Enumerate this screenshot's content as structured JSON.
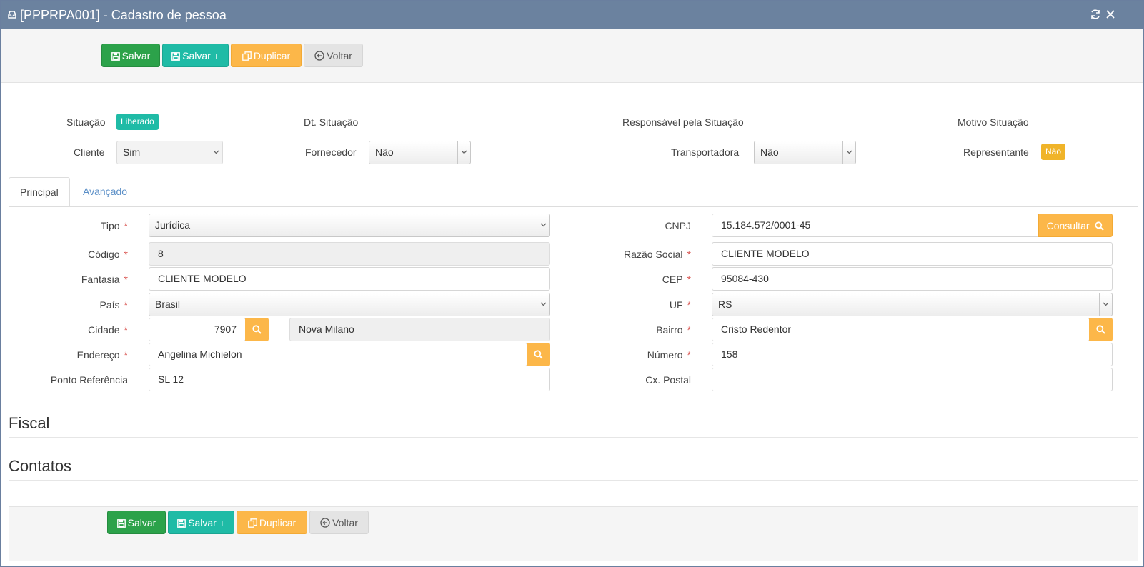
{
  "window": {
    "title": "[PPPRPA001] - Cadastro de pessoa",
    "icons": [
      "inbox-icon",
      "refresh-icon",
      "close-icon"
    ]
  },
  "toolbar": {
    "save": "Salvar",
    "save_plus": "Salvar +",
    "duplicate": "Duplicar",
    "back": "Voltar"
  },
  "status": {
    "situacao_label": "Situação",
    "situacao_value": "Liberado",
    "dt_situacao_label": "Dt. Situação",
    "responsavel_label": "Responsável pela Situação",
    "motivo_label": "Motivo Situação",
    "cliente_label": "Cliente",
    "cliente_value": "Sim",
    "fornecedor_label": "Fornecedor",
    "fornecedor_value": "Não",
    "transportadora_label": "Transportadora",
    "transportadora_value": "Não",
    "representante_label": "Representante",
    "representante_value": "Não"
  },
  "tabs": [
    {
      "label": "Principal",
      "active": true
    },
    {
      "label": "Avançado",
      "active": false
    }
  ],
  "form": {
    "required_mark": "*",
    "tipo": {
      "label": "Tipo",
      "value": "Jurídica"
    },
    "codigo": {
      "label": "Código",
      "value": "8"
    },
    "fantasia": {
      "label": "Fantasia",
      "value": "CLIENTE MODELO"
    },
    "pais": {
      "label": "País",
      "value": "Brasil"
    },
    "cidade": {
      "label": "Cidade",
      "code": "7907",
      "name": "Nova Milano"
    },
    "endereco": {
      "label": "Endereço",
      "value": "Angelina Michielon"
    },
    "ponto_referencia": {
      "label": "Ponto Referência",
      "value": "SL 12"
    },
    "cnpj": {
      "label": "CNPJ",
      "value": "15.184.572/0001-45",
      "button": "Consultar"
    },
    "razao_social": {
      "label": "Razão Social",
      "value": "CLIENTE MODELO"
    },
    "cep": {
      "label": "CEP",
      "value": "95084-430"
    },
    "uf": {
      "label": "UF",
      "value": "RS"
    },
    "bairro": {
      "label": "Bairro",
      "value": "Cristo Redentor"
    },
    "numero": {
      "label": "Número",
      "value": "158"
    },
    "cx_postal": {
      "label": "Cx. Postal",
      "value": ""
    }
  },
  "sections": {
    "fiscal": "Fiscal",
    "contatos": "Contatos"
  },
  "colors": {
    "titlebar": "#6b829f",
    "green": "#2ca24a",
    "teal": "#1fbba6",
    "orange": "#fcb749",
    "badge_liberado": "#1fbba6",
    "badge_nao": "#f0b429",
    "required": "#d9534f"
  }
}
